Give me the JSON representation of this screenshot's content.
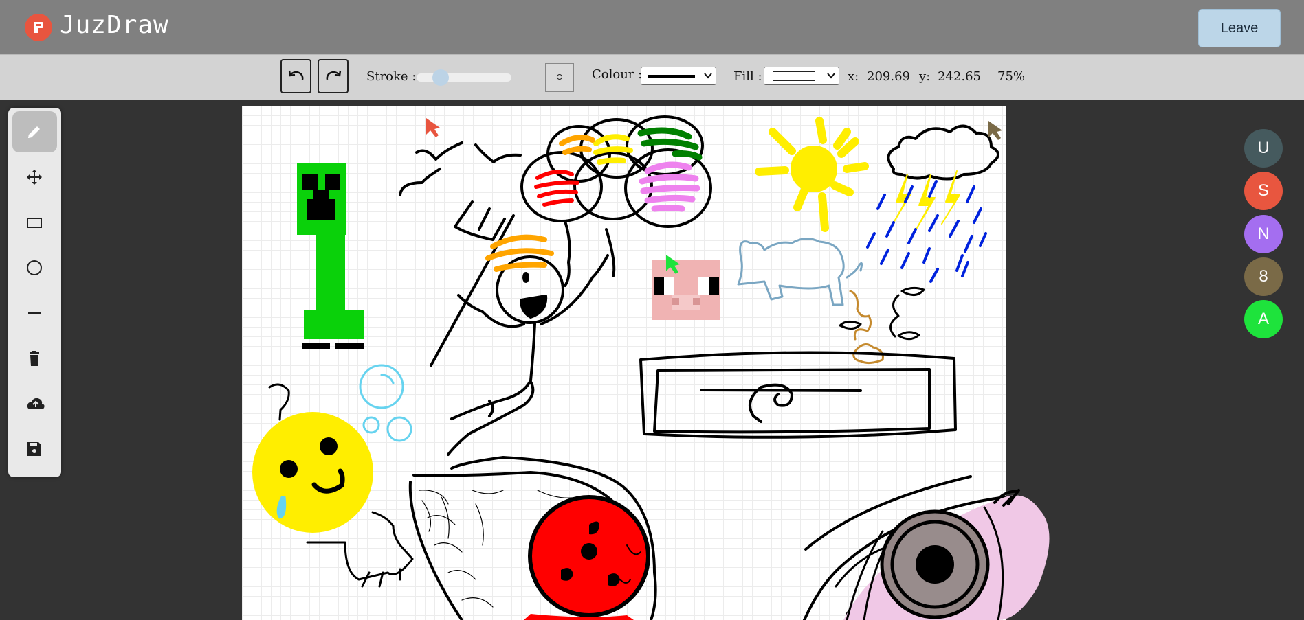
{
  "header": {
    "brand": "JuzDraw",
    "leave_label": "Leave"
  },
  "toolbar": {
    "stroke_label": "Stroke :",
    "stroke_level": 0.2,
    "colour_label": "Colour :",
    "fill_label": "Fill :",
    "x_label": "x:",
    "x_value": "209.69",
    "y_label": "y:",
    "y_value": "242.65",
    "zoom": "75%"
  },
  "tools": [
    "pencil-icon",
    "move-icon",
    "rectangle-icon",
    "circle-icon",
    "line-icon",
    "trash-icon",
    "upload-icon",
    "save-icon"
  ],
  "users": [
    {
      "initial": "U",
      "color": "#455a5e"
    },
    {
      "initial": "S",
      "color": "#e8563f"
    },
    {
      "initial": "N",
      "color": "#a46ef0"
    },
    {
      "initial": "8",
      "color": "#7a6a47"
    },
    {
      "initial": "A",
      "color": "#1ee33c"
    }
  ],
  "colors": {
    "header": "#808080",
    "toolbar": "#d3d3d3",
    "workspace": "#333333",
    "leave": "#bcd6e8",
    "brand_logo": "#e8553f"
  }
}
